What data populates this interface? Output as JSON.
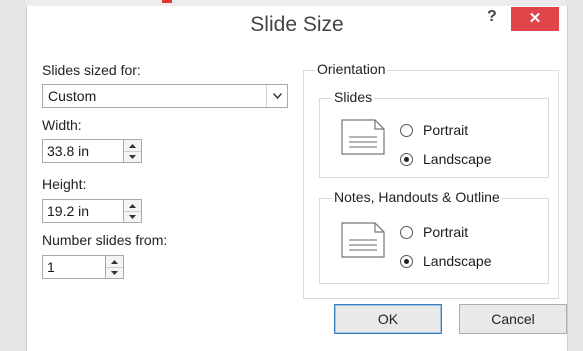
{
  "dialog": {
    "title": "Slide Size",
    "help_glyph": "?",
    "close_glyph": "✕"
  },
  "left": {
    "sized_for_label": "Slides sized for:",
    "sized_for_value": "Custom",
    "width_label": "Width:",
    "width_value": "33.8 in",
    "height_label": "Height:",
    "height_value": "19.2 in",
    "number_from_label": "Number slides from:",
    "number_from_value": "1"
  },
  "orientation": {
    "label": "Orientation",
    "slides": {
      "label": "Slides",
      "portrait_label": "Portrait",
      "landscape_label": "Landscape",
      "selected": "landscape"
    },
    "notes": {
      "label": "Notes, Handouts & Outline",
      "portrait_label": "Portrait",
      "landscape_label": "Landscape",
      "selected": "landscape"
    }
  },
  "buttons": {
    "ok_label": "OK",
    "cancel_label": "Cancel"
  },
  "colors": {
    "close_button": "#e0454a",
    "default_button_border": "#3c7fc1"
  },
  "icons": [
    "help-icon",
    "close-icon",
    "chevron-down-icon",
    "spin-up-icon",
    "spin-down-icon",
    "page-icon"
  ]
}
